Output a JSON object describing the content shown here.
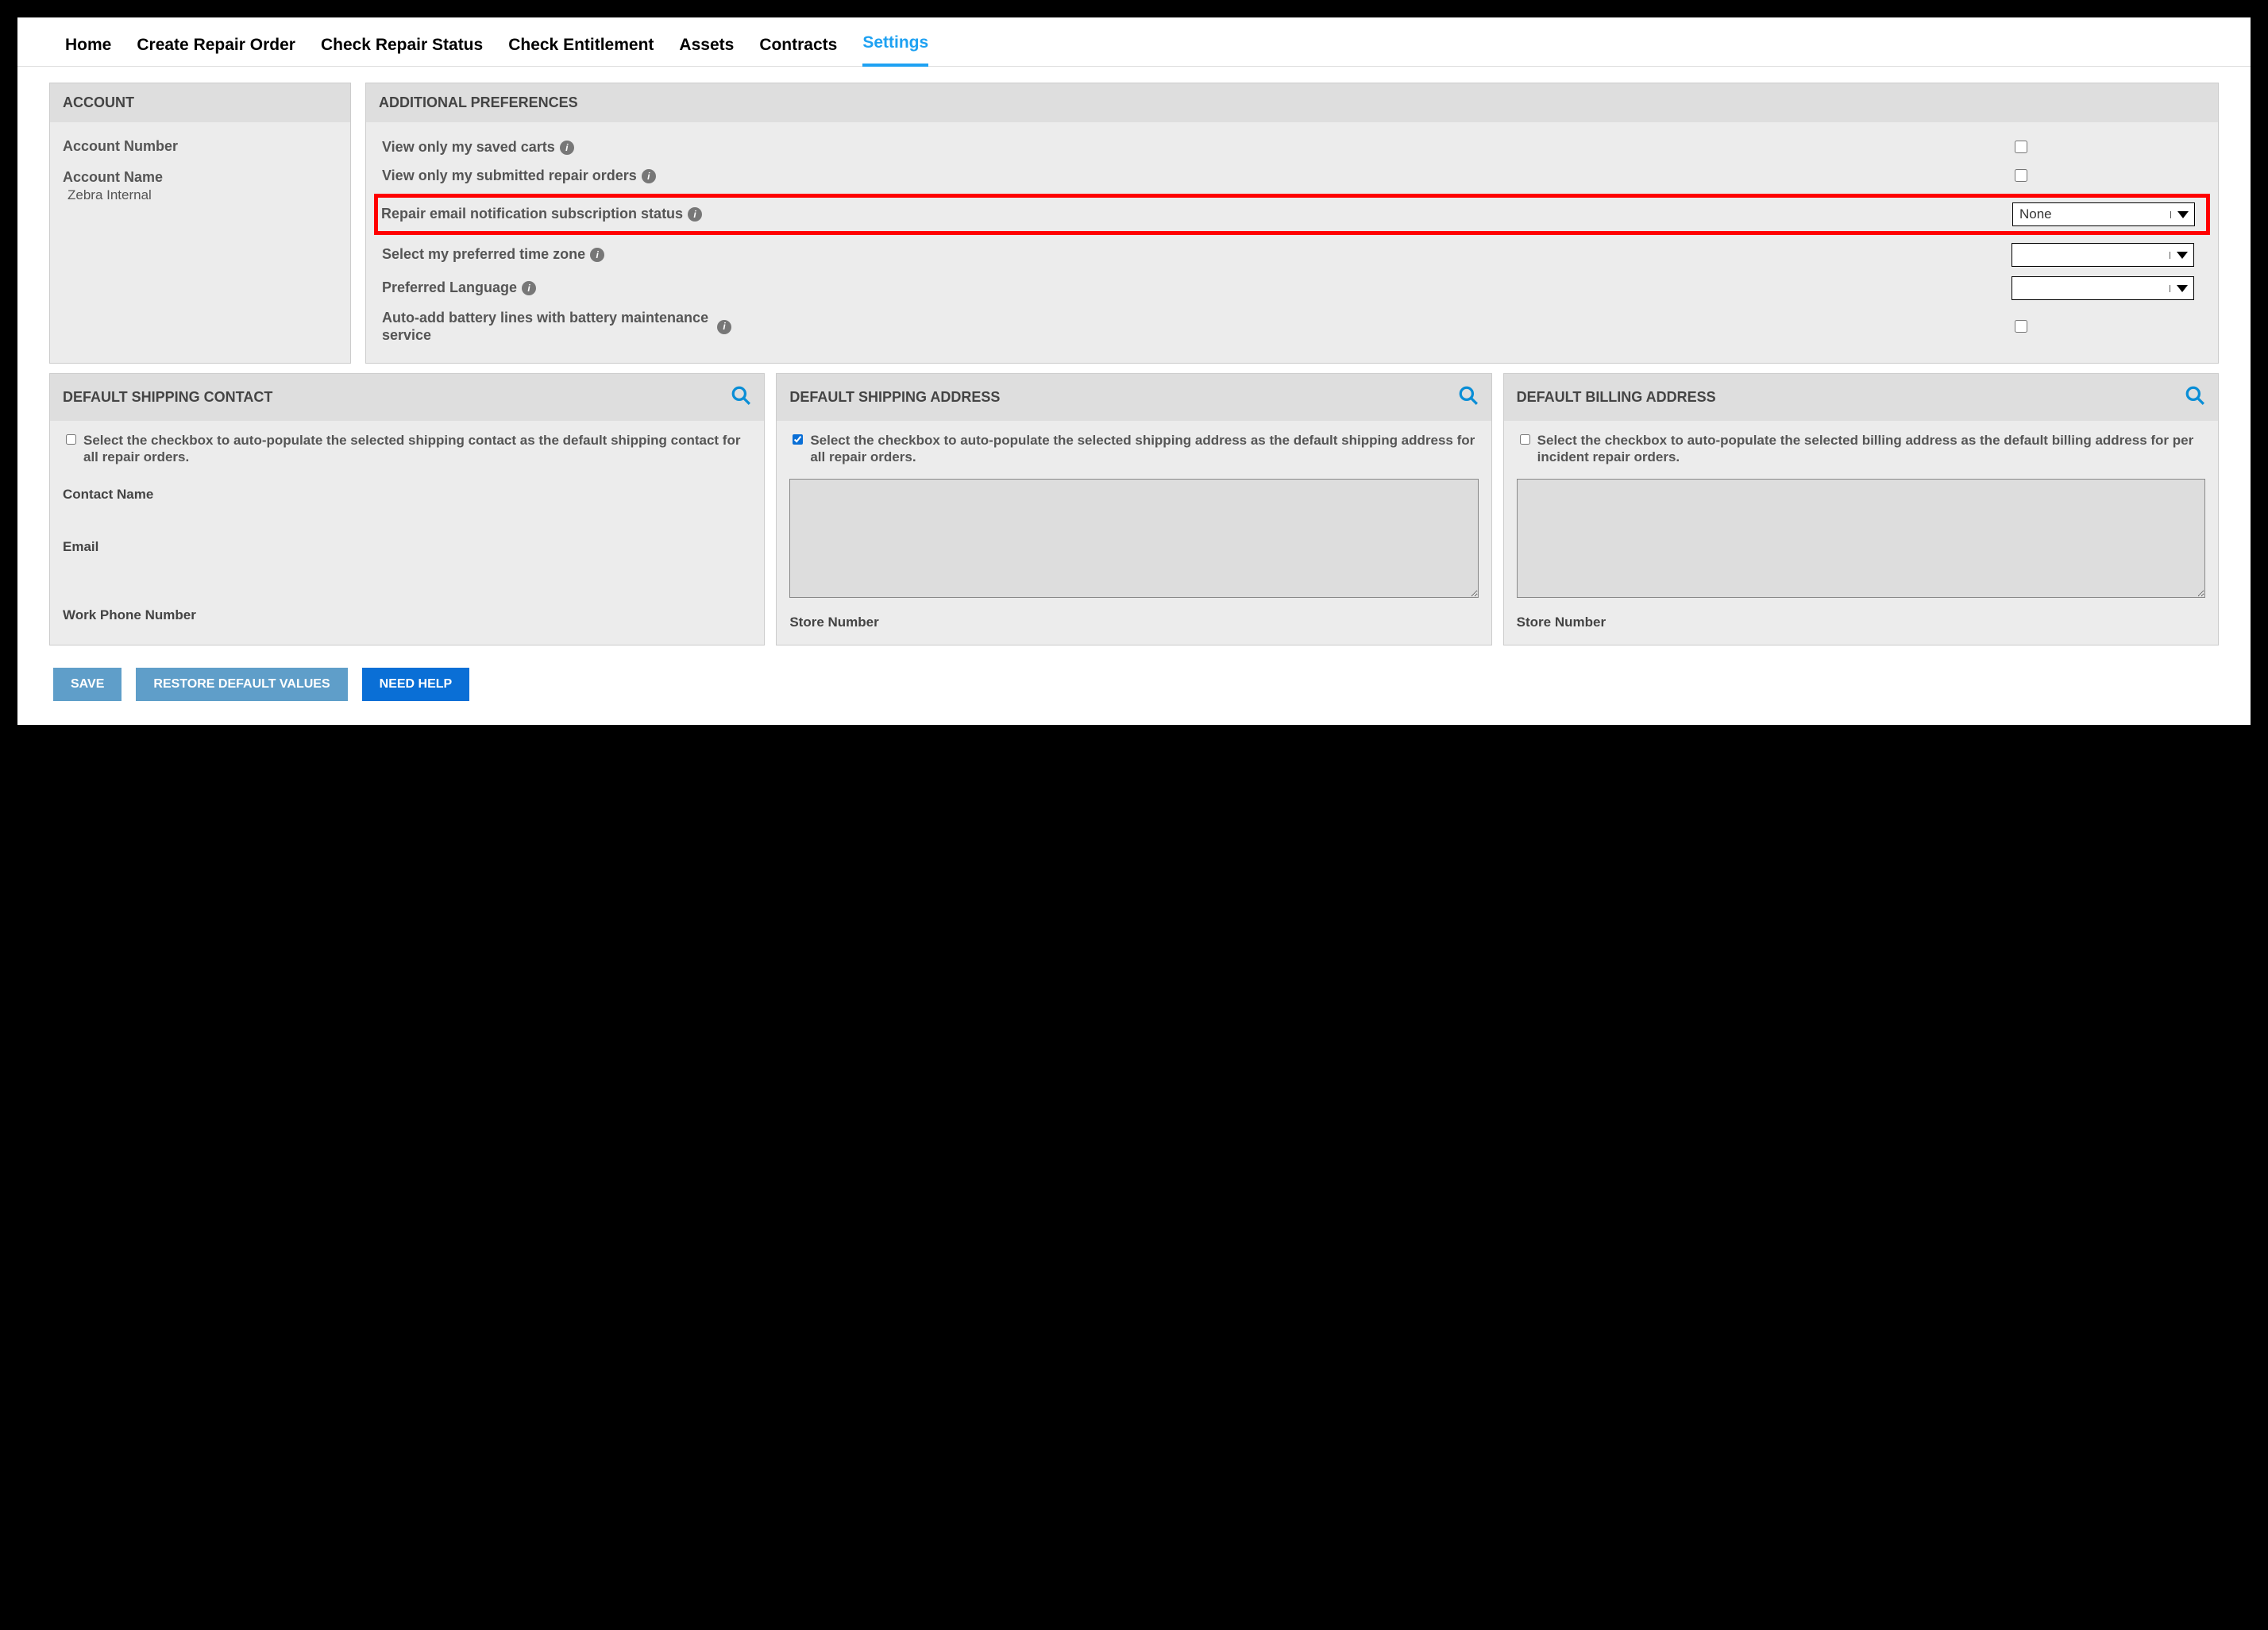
{
  "nav": {
    "items": [
      {
        "label": "Home",
        "active": false
      },
      {
        "label": "Create Repair Order",
        "active": false
      },
      {
        "label": "Check Repair Status",
        "active": false
      },
      {
        "label": "Check Entitlement",
        "active": false
      },
      {
        "label": "Assets",
        "active": false
      },
      {
        "label": "Contracts",
        "active": false
      },
      {
        "label": "Settings",
        "active": true
      }
    ]
  },
  "account": {
    "title": "ACCOUNT",
    "number_label": "Account Number",
    "number_value": "",
    "name_label": "Account Name",
    "name_value": "Zebra Internal"
  },
  "prefs": {
    "title": "ADDITIONAL PREFERENCES",
    "view_carts_label": "View only my saved carts",
    "view_carts_checked": false,
    "view_orders_label": "View only my submitted repair orders",
    "view_orders_checked": false,
    "email_sub_label": "Repair email notification subscription status",
    "email_sub_value": "None",
    "timezone_label": "Select my preferred time zone",
    "timezone_value": "",
    "language_label": "Preferred Language",
    "language_value": "",
    "battery_label": "Auto-add battery lines with battery maintenance service",
    "battery_checked": false
  },
  "shipping_contact": {
    "title": "DEFAULT SHIPPING CONTACT",
    "cb_text": "Select the checkbox to auto-populate the selected shipping contact as the default shipping contact for all repair orders.",
    "cb_checked": false,
    "f1": "Contact Name",
    "f2": "Email",
    "f3": "Work Phone Number"
  },
  "shipping_address": {
    "title": "DEFAULT SHIPPING ADDRESS",
    "cb_text": "Select the checkbox to auto-populate the selected shipping address as the default shipping address for all repair orders.",
    "cb_checked": true,
    "store_label": "Store Number"
  },
  "billing_address": {
    "title": "DEFAULT BILLING ADDRESS",
    "cb_text": "Select the checkbox to auto-populate the selected billing address as the default billing address for per incident repair orders.",
    "cb_checked": false,
    "store_label": "Store Number"
  },
  "buttons": {
    "save": "SAVE",
    "restore": "RESTORE DEFAULT VALUES",
    "help": "NEED HELP"
  }
}
